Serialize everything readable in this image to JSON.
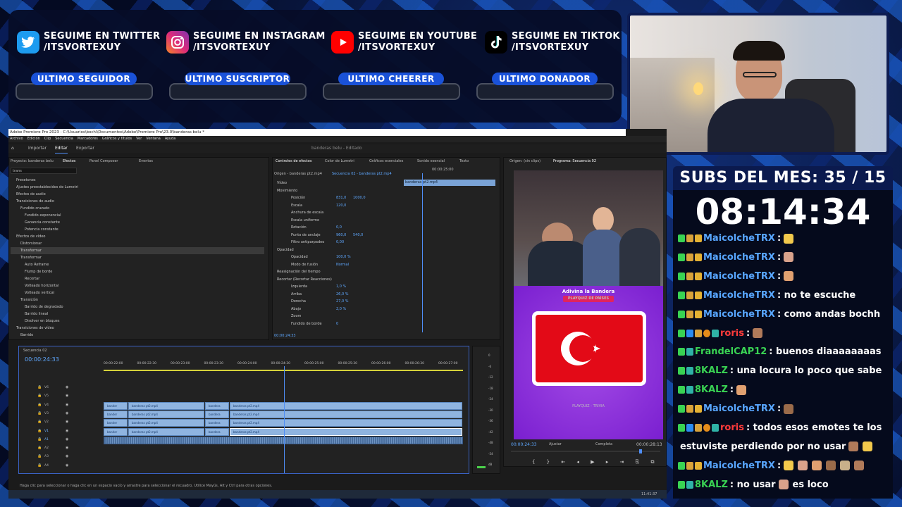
{
  "socials": [
    {
      "icon": "twitter-icon",
      "line1": "SEGUIME EN TWITTER",
      "line2": "/ITSVORTEXUY",
      "color": "#1d9bf0"
    },
    {
      "icon": "instagram-icon",
      "line1": "SEGUIME EN INSTAGRAM",
      "line2": "/ITSVORTEXUY",
      "color": "#d6249f"
    },
    {
      "icon": "youtube-icon",
      "line1": "SEGUIME EN YOUTUBE",
      "line2": "/ITSVORTEXUY",
      "color": "#ff0000"
    },
    {
      "icon": "tiktok-icon",
      "line1": "SEGUIME EN TIKTOK",
      "line2": "/ITSVORTEXUY",
      "color": "#000000"
    }
  ],
  "labels": {
    "follower": "ULTIMO SEGUIDOR",
    "subscriber": "ULTIMO SUSCRIPTOR",
    "cheerer": "ULTIMO CHEERER",
    "donor": "ULTIMO DONADOR"
  },
  "premiere": {
    "title": "Adobe Premiere Pro 2023 - C:\\Usuarios\\bochi\\Documentos\\Adobe\\Premiere Pro\\23.0\\banderas belu *",
    "menu": [
      "Archivo",
      "Edición",
      "Clip",
      "Secuencia",
      "Marcadores",
      "Gráficos y títulos",
      "Ver",
      "Ventana",
      "Ayuda"
    ],
    "workspace_tabs": [
      "Importar",
      "Editar",
      "Exportar"
    ],
    "project_name": "banderas belu - Editado",
    "effects_panel": {
      "project_label": "Proyecto: banderas belu",
      "tabs": [
        "Efectos",
        "Panel Composer",
        "Eventos"
      ],
      "search": "trans",
      "tree": [
        "Presetones",
        "Ajustes preestablecidos de Lumetri",
        "Efectos de audio",
        "Transiciones de audio",
        "Fundido cruzado",
        "Fundido exponencial",
        "Ganancia constante",
        "Potencia constante",
        "Efectos de vídeo",
        "Distorsionar",
        "Transformar",
        "Transformar",
        "Auto Reframe",
        "Flump de borde",
        "Recortar",
        "Volteado horizontal",
        "Volteado vertical",
        "Transición",
        "Barrido de degradado",
        "Barrido lineal",
        "Disolver en bloques",
        "Transiciones de vídeo",
        "Barrido"
      ]
    },
    "effect_controls": {
      "tabs": [
        "Controles de efectos",
        "Color de Lumetri",
        "Gráficos esenciales",
        "Sonido esencial",
        "Texto"
      ],
      "source": "Origen - banderas pt2.mp4",
      "seq": "Secuencia 02 - banderas pt2.mp4",
      "clip_label": "banderas pt2.mp4",
      "timecode_mini": "00:00:25:00",
      "rows": [
        {
          "name": "Vídeo",
          "v1": "",
          "v2": ""
        },
        {
          "name": "Movimiento",
          "v1": "",
          "v2": ""
        },
        {
          "name": "Posición",
          "v1": "831,0",
          "v2": "1000,0"
        },
        {
          "name": "Escala",
          "v1": "120,0",
          "v2": ""
        },
        {
          "name": "Anchura de escala",
          "v1": "",
          "v2": ""
        },
        {
          "name": "Escala uniforme",
          "v1": "",
          "v2": ""
        },
        {
          "name": "Rotación",
          "v1": "0,0",
          "v2": ""
        },
        {
          "name": "Punto de anclaje",
          "v1": "960,0",
          "v2": "540,0"
        },
        {
          "name": "Filtro antiparpadeo",
          "v1": "0,00",
          "v2": ""
        },
        {
          "name": "Opacidad",
          "v1": "",
          "v2": ""
        },
        {
          "name": "Opacidad",
          "v1": "100,0 %",
          "v2": ""
        },
        {
          "name": "Modo de fusión",
          "v1": "Normal",
          "v2": ""
        },
        {
          "name": "Reasignación del tiempo",
          "v1": "",
          "v2": ""
        },
        {
          "name": "Recortar (Recortar Reacciones)",
          "v1": "",
          "v2": ""
        },
        {
          "name": "Izquierda",
          "v1": "1,0 %",
          "v2": ""
        },
        {
          "name": "Arriba",
          "v1": "26,0 %",
          "v2": ""
        },
        {
          "name": "Derecha",
          "v1": "27,0 %",
          "v2": ""
        },
        {
          "name": "Abajo",
          "v1": "2,0 %",
          "v2": ""
        },
        {
          "name": "Zoom",
          "v1": "",
          "v2": ""
        },
        {
          "name": "Fundido de borde",
          "v1": "0",
          "v2": ""
        }
      ],
      "footer_tc": "00:00:24:33"
    },
    "source_tab": "Origen: (sin clips)",
    "program_tab": "Programa: Secuencia 02",
    "program": {
      "tc_left": "00:00:24:33",
      "fit": "Ajustar",
      "quality": "Completa",
      "tc_right": "00:00:28:13",
      "video_title": "Adivina la Bandera",
      "video_sub": "PLAYQUIZ DE PAÍSES",
      "video_brand": "PLAYQUIZ - TRIVIA"
    },
    "timeline": {
      "seq_tab": "Secuencia 02",
      "tc": "00:00:24:33",
      "ruler": [
        "00:00:22:00",
        "00:00:22:30",
        "00:00:23:00",
        "00:00:23:30",
        "00:00:24:00",
        "00:00:24:30",
        "00:00:25:00",
        "00:00:25:30",
        "00:00:26:00",
        "00:00:26:30",
        "00:00:27:00"
      ],
      "tracks": [
        "V6",
        "V5",
        "V4",
        "V3",
        "V2",
        "V1",
        "A1",
        "A2",
        "A3",
        "A4"
      ],
      "clip_a": "banderas pt2.mp4",
      "clip_b": "banderas pt2.mp4",
      "clip_short": "bander",
      "clip_short2": "bandera"
    },
    "meter": [
      "0",
      "-6",
      "-12",
      "-18",
      "-24",
      "-30",
      "-36",
      "-42",
      "-48",
      "-54",
      "dB"
    ],
    "status": "Haga clic para seleccionar o haga clic en un espacio vacío y arrastre para seleccionar el recuadro. Utilice Mayús, Alt y Ctrl para otras opciones.",
    "clock": "11:41:37"
  },
  "subs": {
    "title": "SUBS DEL MES: 35 / 15",
    "timer": "08:14:34"
  },
  "chat": [
    {
      "user": "MaicolcheTRX",
      "color": "#58a6ff",
      "msg": ":",
      "badges": "mod",
      "emotes": 1
    },
    {
      "user": "MaicolcheTRX",
      "color": "#58a6ff",
      "msg": ":",
      "badges": "mod",
      "emotes": 1
    },
    {
      "user": "MaicolcheTRX",
      "color": "#58a6ff",
      "msg": ":",
      "badges": "mod",
      "emotes": 1
    },
    {
      "user": "MaicolcheTRX",
      "color": "#58a6ff",
      "msg": ": no te escuche",
      "badges": "mod",
      "emotes": 0
    },
    {
      "user": "MaicolcheTRX",
      "color": "#58a6ff",
      "msg": ": como andas bochh",
      "badges": "mod",
      "emotes": 0
    },
    {
      "user": "roris",
      "color": "#ff3b3b",
      "msg": ":",
      "badges": "many",
      "emotes": 1
    },
    {
      "user": "FrandelCAP12",
      "color": "#39d353",
      "msg": ": buenos diaaaaaaaas",
      "badges": "two",
      "emotes": 0
    },
    {
      "user": "8KALZ",
      "color": "#39d353",
      "msg": ": una locura lo poco que sabe",
      "badges": "two",
      "emotes": 0
    },
    {
      "user": "8KALZ",
      "color": "#39d353",
      "msg": ":",
      "badges": "two",
      "emotes": 1
    },
    {
      "user": "MaicolcheTRX",
      "color": "#58a6ff",
      "msg": ":",
      "badges": "mod",
      "emotes": 1
    },
    {
      "user": "roris",
      "color": "#ff3b3b",
      "msg": ": todos esos emotes te los",
      "badges": "many",
      "emotes": 0
    },
    {
      "user": "",
      "color": "#ffffff",
      "msg": "estuviste perdiendo por no usar",
      "badges": "none",
      "emotes": 2
    },
    {
      "user": "MaicolcheTRX",
      "color": "#58a6ff",
      "msg": ":",
      "badges": "mod",
      "emotes": 6
    },
    {
      "user": "8KALZ",
      "color": "#39d353",
      "msg": ": no usar",
      "badges": "two",
      "emotes": 1,
      "tail": "es loco"
    }
  ]
}
